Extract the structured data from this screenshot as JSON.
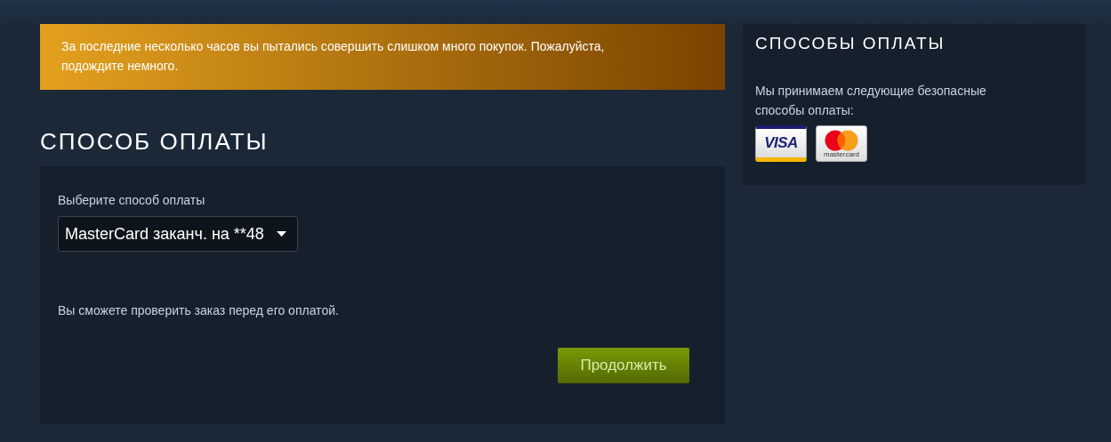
{
  "warning": {
    "text": "За последние несколько часов вы пытались совершить слишком много покупок. Пожалуйста, подождите немного."
  },
  "payment": {
    "title": "СПОСОБ ОПЛАТЫ",
    "select_label": "Выберите способ оплаты",
    "selected_method": "MasterCard заканч. на **48",
    "note": "Вы сможете проверить заказ перед его оплатой.",
    "continue_button": "Продолжить"
  },
  "sidebar": {
    "title": "СПОСОБЫ ОПЛАТЫ",
    "text": "Мы принимаем следующие безопасные способы оплаты:",
    "cards": [
      {
        "kind": "visa",
        "label": "VISA"
      },
      {
        "kind": "mastercard",
        "label": "mastercard"
      }
    ]
  }
}
